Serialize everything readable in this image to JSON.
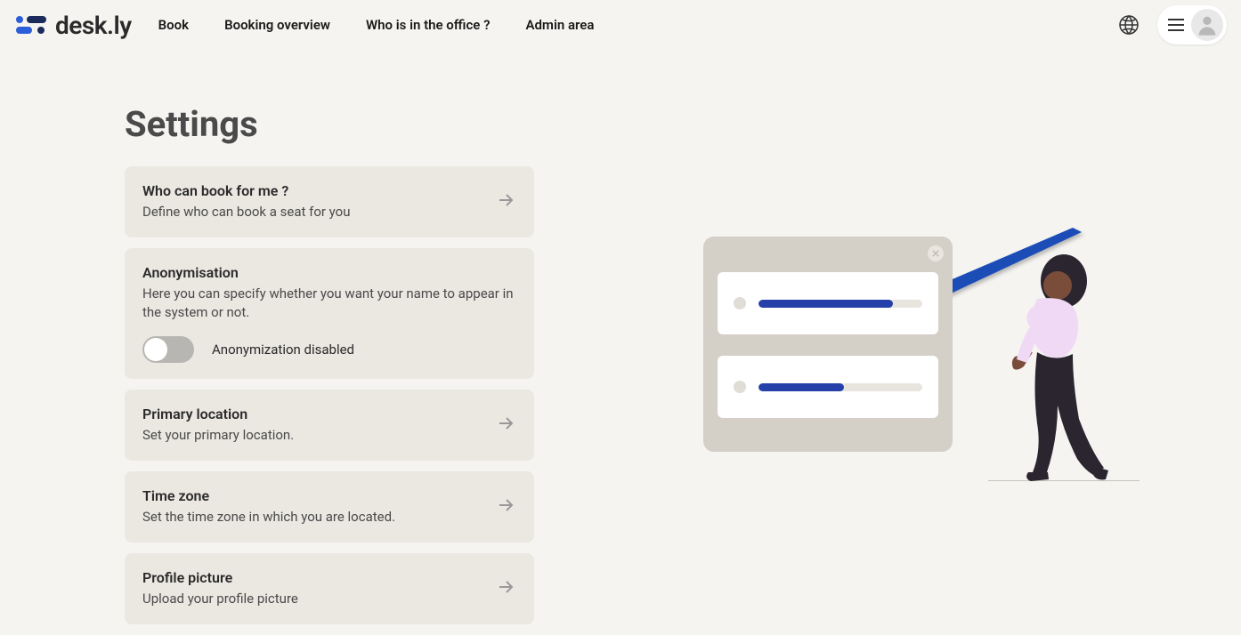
{
  "brand": {
    "name": "desk.ly"
  },
  "nav": {
    "items": [
      {
        "label": "Book"
      },
      {
        "label": "Booking overview"
      },
      {
        "label": "Who is in the office ?"
      },
      {
        "label": "Admin area"
      }
    ]
  },
  "page": {
    "title": "Settings"
  },
  "settings": {
    "who_can_book": {
      "title": "Who can book for me ?",
      "desc": "Define who can book a seat for you"
    },
    "anonymisation": {
      "title": "Anonymisation",
      "desc": "Here you can specify whether you want your name to appear in the system or not.",
      "toggle_label": "Anonymization disabled"
    },
    "primary_location": {
      "title": "Primary location",
      "desc": "Set your primary location."
    },
    "time_zone": {
      "title": "Time zone",
      "desc": "Set the time zone in which you are located."
    },
    "profile_picture": {
      "title": "Profile picture",
      "desc": "Upload your profile picture"
    }
  },
  "colors": {
    "accent": "#2540a8",
    "card_bg": "#ebe8e2",
    "page_bg": "#f5f4f1"
  }
}
